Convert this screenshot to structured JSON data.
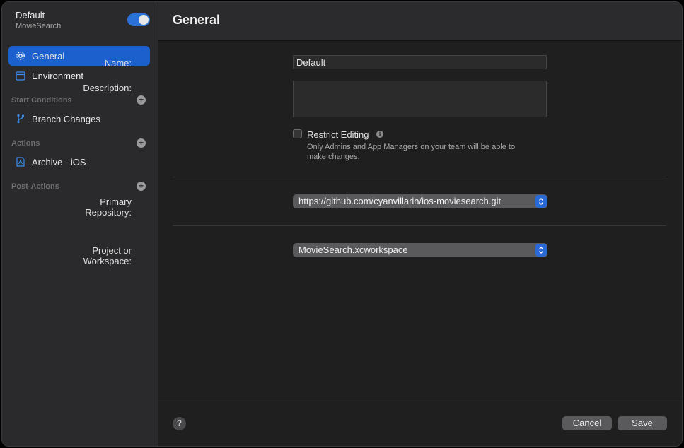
{
  "sidebar": {
    "workflow_name": "Default",
    "product_name": "MovieSearch",
    "toggle_enabled": true,
    "items": [
      {
        "label": "General",
        "icon": "gear-icon",
        "active": true
      },
      {
        "label": "Environment",
        "icon": "environment-icon",
        "active": false
      }
    ],
    "sections": [
      {
        "label": "Start Conditions",
        "items": [
          {
            "label": "Branch Changes",
            "icon": "branch-icon"
          }
        ]
      },
      {
        "label": "Actions",
        "items": [
          {
            "label": "Archive - iOS",
            "icon": "archive-icon"
          }
        ]
      },
      {
        "label": "Post-Actions",
        "items": []
      }
    ],
    "add_icon": "+"
  },
  "header": {
    "title": "General"
  },
  "form": {
    "name_label": "Name:",
    "name_value": "Default",
    "description_label": "Description:",
    "description_value": "",
    "restrict_label": "Restrict Editing",
    "restrict_checked": false,
    "info_glyph": "i",
    "restrict_help_line1": "Only Admins and App Managers on your team will be able to",
    "restrict_help_line2": "make changes.",
    "repo_label": "Primary Repository:",
    "repo_value": "https://github.com/cyanvillarin/ios-moviesearch.git",
    "project_label": "Project or Workspace:",
    "project_value": "MovieSearch.xcworkspace"
  },
  "footer": {
    "help_glyph": "?",
    "cancel_label": "Cancel",
    "save_label": "Save"
  },
  "colors": {
    "accent": "#1b60cc",
    "toggle": "#2a72d8"
  }
}
